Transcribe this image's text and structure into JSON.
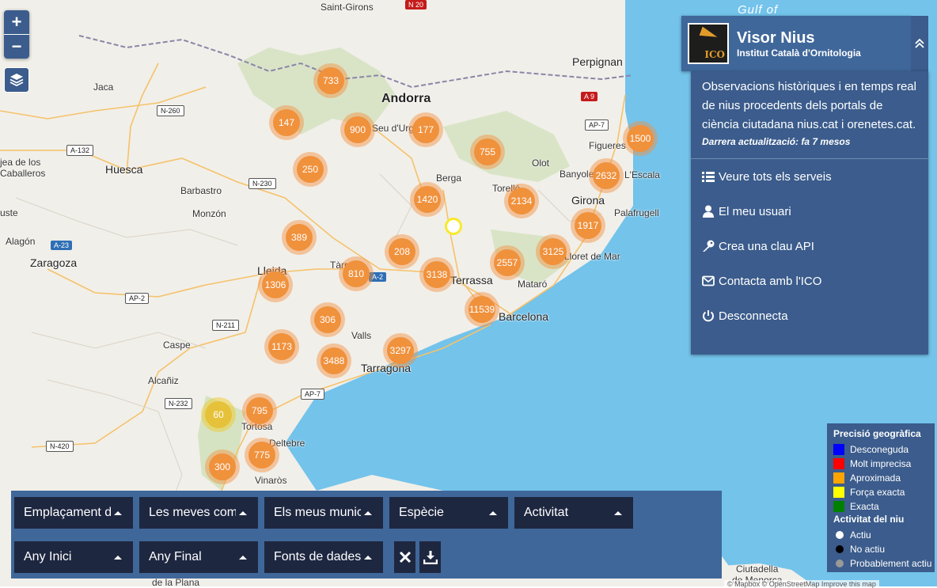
{
  "app": {
    "title": "Visor Nius",
    "subtitle": "Institut Català d'Ornitologia",
    "logo_text": "ICO",
    "description": "Observacions històriques i en temps real de nius procedents dels portals de ciència ciutadana nius.cat i orenetes.cat.",
    "last_update": "Darrera actualització: fa 7 mesos"
  },
  "menu": [
    {
      "label": "Veure tots els serveis",
      "icon": "list-icon"
    },
    {
      "label": "El meu usuari",
      "icon": "user-icon"
    },
    {
      "label": "Crea una clau API",
      "icon": "key-icon"
    },
    {
      "label": "Contacta amb l'ICO",
      "icon": "envelope-icon"
    },
    {
      "label": "Desconnecta",
      "icon": "power-icon"
    }
  ],
  "zoom": {
    "in": "+",
    "out": "−"
  },
  "filters": [
    {
      "label": "Emplaçament de"
    },
    {
      "label": "Les meves com"
    },
    {
      "label": "Els meus munici"
    },
    {
      "label": "Espècie"
    },
    {
      "label": "Activitat"
    },
    {
      "label": "Any Inici"
    },
    {
      "label": "Any Final"
    },
    {
      "label": "Fonts de dades"
    }
  ],
  "legend": {
    "precision_title": "Precisió geogràfica",
    "precision": [
      {
        "label": "Desconeguda",
        "color": "#0000ff"
      },
      {
        "label": "Molt imprecisa",
        "color": "#ff0000"
      },
      {
        "label": "Aproximada",
        "color": "#ffa500"
      },
      {
        "label": "Força exacta",
        "color": "#ffff00"
      },
      {
        "label": "Exacta",
        "color": "#008000"
      }
    ],
    "activity_title": "Activitat del niu",
    "activity": [
      {
        "label": "Actiu",
        "color": "#ffffff"
      },
      {
        "label": "No actiu",
        "color": "#000000"
      },
      {
        "label": "Probablement actiu",
        "color": "#999999"
      }
    ]
  },
  "clusters": [
    {
      "count": "733",
      "color": "orange"
    },
    {
      "count": "147",
      "color": "orange"
    },
    {
      "count": "900",
      "color": "orange"
    },
    {
      "count": "177",
      "color": "orange"
    },
    {
      "count": "755",
      "color": "orange"
    },
    {
      "count": "1500",
      "color": "orange"
    },
    {
      "count": "250",
      "color": "orange"
    },
    {
      "count": "1420",
      "color": "orange"
    },
    {
      "count": "2134",
      "color": "orange"
    },
    {
      "count": "2632",
      "color": "orange"
    },
    {
      "count": "389",
      "color": "orange"
    },
    {
      "count": "1917",
      "color": "orange"
    },
    {
      "count": "208",
      "color": "orange"
    },
    {
      "count": "3125",
      "color": "orange"
    },
    {
      "count": "2557",
      "color": "orange"
    },
    {
      "count": "810",
      "color": "orange"
    },
    {
      "count": "3138",
      "color": "orange"
    },
    {
      "count": "1306",
      "color": "orange"
    },
    {
      "count": "11539",
      "color": "orange"
    },
    {
      "count": "306",
      "color": "orange"
    },
    {
      "count": "1173",
      "color": "orange"
    },
    {
      "count": "3297",
      "color": "orange"
    },
    {
      "count": "3488",
      "color": "orange"
    },
    {
      "count": "60",
      "color": "yellow"
    },
    {
      "count": "795",
      "color": "orange"
    },
    {
      "count": "775",
      "color": "orange"
    },
    {
      "count": "300",
      "color": "orange"
    }
  ],
  "places": [
    {
      "name": "Saint-Girons",
      "cls": ""
    },
    {
      "name": "Gulf of",
      "cls": "sea"
    },
    {
      "name": "Jaca",
      "cls": ""
    },
    {
      "name": "Andorra",
      "cls": "big"
    },
    {
      "name": "Perpignan",
      "cls": "med"
    },
    {
      "name": "Seu d'Urgell",
      "cls": ""
    },
    {
      "name": "Figueres",
      "cls": ""
    },
    {
      "name": "jea de los",
      "cls": ""
    },
    {
      "name": "Caballeros",
      "cls": ""
    },
    {
      "name": "Huesca",
      "cls": "med"
    },
    {
      "name": "Olot",
      "cls": ""
    },
    {
      "name": "Banyoles",
      "cls": ""
    },
    {
      "name": "L'Escala",
      "cls": ""
    },
    {
      "name": "Berga",
      "cls": ""
    },
    {
      "name": "Barbastro",
      "cls": ""
    },
    {
      "name": "Torelló",
      "cls": ""
    },
    {
      "name": "Girona",
      "cls": "med"
    },
    {
      "name": "Monzón",
      "cls": ""
    },
    {
      "name": "Palafrugell",
      "cls": ""
    },
    {
      "name": "uste",
      "cls": ""
    },
    {
      "name": "Alagón",
      "cls": ""
    },
    {
      "name": "Lloret de Mar",
      "cls": ""
    },
    {
      "name": "Zaragoza",
      "cls": "med"
    },
    {
      "name": "Tàrrega",
      "cls": ""
    },
    {
      "name": "Lleida",
      "cls": "med"
    },
    {
      "name": "Terrassa",
      "cls": "med"
    },
    {
      "name": "Mataró",
      "cls": ""
    },
    {
      "name": "Barcelona",
      "cls": "med"
    },
    {
      "name": "Valls",
      "cls": ""
    },
    {
      "name": "Caspe",
      "cls": ""
    },
    {
      "name": "Tarragona",
      "cls": "med"
    },
    {
      "name": "Alcañiz",
      "cls": ""
    },
    {
      "name": "Tortosa",
      "cls": ""
    },
    {
      "name": "Deltebre",
      "cls": ""
    },
    {
      "name": "Vinaròs",
      "cls": ""
    },
    {
      "name": "Ciutadella",
      "cls": ""
    },
    {
      "name": "de Menorca",
      "cls": ""
    },
    {
      "name": "de la Plana",
      "cls": ""
    }
  ],
  "roads": [
    {
      "name": "N-260",
      "type": "w"
    },
    {
      "name": "A-132",
      "type": "w"
    },
    {
      "name": "N-230",
      "type": "w"
    },
    {
      "name": "A-23",
      "type": "b"
    },
    {
      "name": "AP-2",
      "type": "w"
    },
    {
      "name": "A-2",
      "type": "b"
    },
    {
      "name": "N-211",
      "type": "w"
    },
    {
      "name": "N-232",
      "type": "w"
    },
    {
      "name": "AP-7",
      "type": "w"
    },
    {
      "name": "AP-7",
      "type": "w"
    },
    {
      "name": "N-420",
      "type": "w"
    },
    {
      "name": "A 9",
      "type": "r"
    },
    {
      "name": "N 20",
      "type": "r"
    }
  ],
  "attribution": "© Mapbox © OpenStreetMap Improve this map"
}
